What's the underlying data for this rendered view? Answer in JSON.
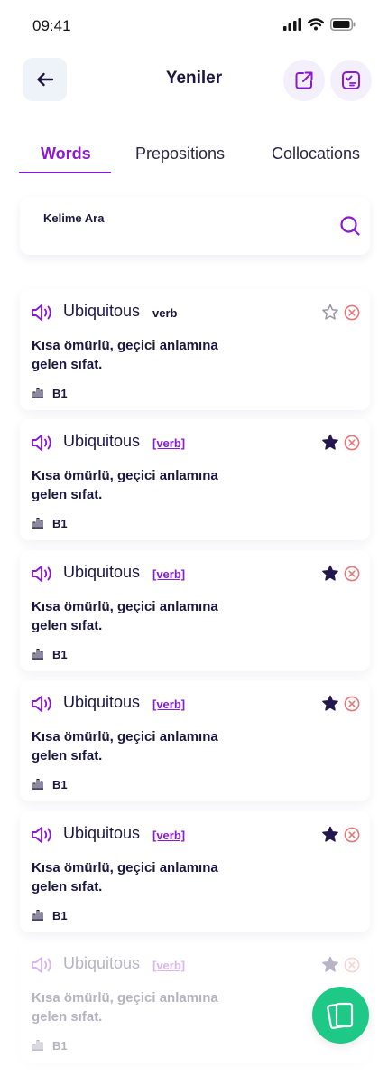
{
  "status_bar": {
    "time": "09:41"
  },
  "header": {
    "title": "Yeniler"
  },
  "tabs": [
    {
      "label": "Words",
      "active": true
    },
    {
      "label": "Prepositions",
      "active": false
    },
    {
      "label": "Collocations",
      "active": false
    }
  ],
  "search": {
    "label": "Kelime Ara"
  },
  "cards": [
    {
      "word": "Ubiquitous",
      "pos": "verb",
      "pos_style": "plain",
      "starred": false,
      "definition": "Kısa ömürlü, geçici anlamına gelen sıfat.",
      "level": "B1"
    },
    {
      "word": "Ubiquitous",
      "pos": "[verb]",
      "pos_style": "link",
      "starred": true,
      "definition": "Kısa ömürlü, geçici anlamına gelen sıfat.",
      "level": "B1"
    },
    {
      "word": "Ubiquitous",
      "pos": "[verb]",
      "pos_style": "link",
      "starred": true,
      "definition": "Kısa ömürlü, geçici anlamına gelen sıfat.",
      "level": "B1"
    },
    {
      "word": "Ubiquitous",
      "pos": "[verb]",
      "pos_style": "link",
      "starred": true,
      "definition": "Kısa ömürlü, geçici anlamına gelen sıfat.",
      "level": "B1"
    },
    {
      "word": "Ubiquitous",
      "pos": "[verb]",
      "pos_style": "link",
      "starred": true,
      "definition": "Kısa ömürlü, geçici anlamına gelen sıfat.",
      "level": "B1"
    },
    {
      "word": "Ubiquitous",
      "pos": "[verb]",
      "pos_style": "link",
      "starred": true,
      "definition": "Kısa ömürlü, geçici anlamına gelen sıfat.",
      "level": "B1"
    }
  ],
  "colors": {
    "accent": "#8a1ad0",
    "text": "#1b1640",
    "remove": "#e0797a",
    "fab": "#1ec987",
    "star_filled": "#23184d",
    "star_empty": "#9a94a8"
  },
  "icons": {
    "back": "arrow-left-icon",
    "share": "share-icon",
    "quiz": "quiz-icon",
    "search": "search-icon",
    "speaker": "speaker-icon",
    "star": "star-icon",
    "remove": "close-circle-icon",
    "level": "level-bars-icon",
    "flashcards": "flashcards-icon"
  }
}
